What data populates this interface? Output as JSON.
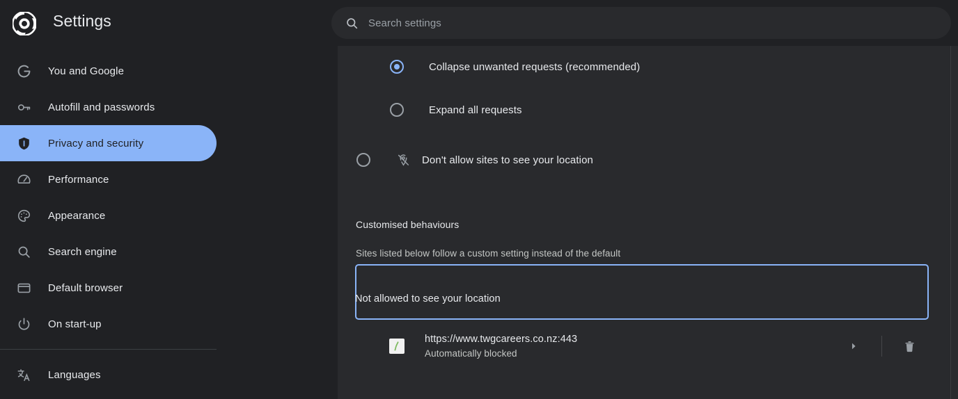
{
  "header": {
    "logo_icon": "chrome-logo-icon",
    "title": "Settings",
    "search": {
      "icon": "search-icon",
      "placeholder": "Search settings",
      "value": ""
    }
  },
  "sidebar": {
    "items": [
      {
        "id": "you-and-google",
        "label": "You and Google",
        "icon": "google-g-icon",
        "active": false
      },
      {
        "id": "autofill-passwords",
        "label": "Autofill and passwords",
        "icon": "key-icon",
        "active": false
      },
      {
        "id": "privacy-security",
        "label": "Privacy and security",
        "icon": "shield-icon",
        "active": true
      },
      {
        "id": "performance",
        "label": "Performance",
        "icon": "speedometer-icon",
        "active": false
      },
      {
        "id": "appearance",
        "label": "Appearance",
        "icon": "palette-icon",
        "active": false
      },
      {
        "id": "search-engine",
        "label": "Search engine",
        "icon": "search-icon",
        "active": false
      },
      {
        "id": "default-browser",
        "label": "Default browser",
        "icon": "window-icon",
        "active": false
      },
      {
        "id": "on-start-up",
        "label": "On start-up",
        "icon": "power-icon",
        "active": false
      }
    ],
    "items_after_divider": [
      {
        "id": "languages",
        "label": "Languages",
        "icon": "translate-icon",
        "active": false
      }
    ]
  },
  "main": {
    "radio_group": {
      "options": [
        {
          "id": "collapse-unwanted",
          "label": "Collapse unwanted requests (recommended)",
          "checked": true
        },
        {
          "id": "expand-all",
          "label": "Expand all requests",
          "checked": false
        }
      ]
    },
    "location_option": {
      "id": "dont-allow-location",
      "icon": "location-off-icon",
      "label": "Don't allow sites to see your location",
      "checked": false
    },
    "section": {
      "heading": "Customised behaviours",
      "subtext": "Sites listed below follow a custom setting instead of the default"
    },
    "focus_box": {
      "label": "Not allowed to see your location",
      "border_color": "#8ab4f8"
    },
    "site_entry": {
      "favicon_icon": "site-favicon-icon",
      "url": "https://www.twgcareers.co.nz:443",
      "status": "Automatically blocked",
      "expand_icon": "chevron-right-icon",
      "delete_icon": "trash-icon"
    }
  },
  "colors": {
    "sidebar_bg": "#202124",
    "main_bg": "#292a2d",
    "accent": "#8ab4f8",
    "text_primary": "#e8eaed",
    "text_secondary": "#9aa0a6"
  }
}
